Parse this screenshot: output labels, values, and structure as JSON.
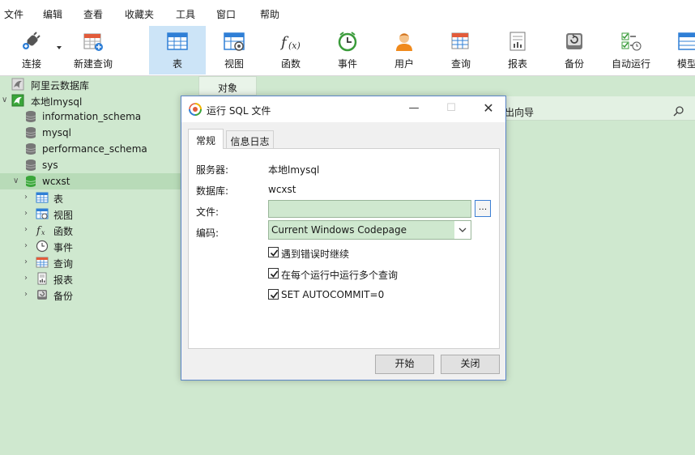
{
  "menu": [
    "文件",
    "编辑",
    "查看",
    "收藏夹",
    "工具",
    "窗口",
    "帮助"
  ],
  "toolbar": {
    "connect": "连接",
    "new_query": "新建查询",
    "table": "表",
    "view": "视图",
    "function": "函数",
    "event": "事件",
    "user": "用户",
    "query": "查询",
    "report": "报表",
    "backup": "备份",
    "automation": "自动运行",
    "model": "模型"
  },
  "sidebar": {
    "connections": [
      {
        "label": "阿里云数据库",
        "icon": "dolphin-icon"
      },
      {
        "label": "本地lmysql",
        "icon": "dolphin-icon"
      }
    ],
    "databases": [
      "information_schema",
      "mysql",
      "performance_schema",
      "sys",
      "wcxst"
    ],
    "children": [
      {
        "label": "表",
        "icon": "table-icon"
      },
      {
        "label": "视图",
        "icon": "view-icon"
      },
      {
        "label": "函数",
        "icon": "function-icon"
      },
      {
        "label": "事件",
        "icon": "clock-icon"
      },
      {
        "label": "查询",
        "icon": "query-icon"
      },
      {
        "label": "报表",
        "icon": "report-icon"
      },
      {
        "label": "备份",
        "icon": "backup-icon"
      }
    ]
  },
  "main": {
    "tab_object": "对象",
    "guide_text": "出向导"
  },
  "dialog": {
    "title": "运行 SQL 文件",
    "tabs": [
      "常规",
      "信息日志"
    ],
    "server_label": "服务器:",
    "server_value": "本地lmysql",
    "database_label": "数据库:",
    "database_value": "wcxst",
    "file_label": "文件:",
    "file_value": "",
    "browse_label": "...",
    "encoding_label": "编码:",
    "encoding_value": "Current Windows Codepage",
    "options": [
      {
        "label": "遇到错误时继续",
        "checked": true
      },
      {
        "label": "在每个运行中运行多个查询",
        "checked": true
      },
      {
        "label": "SET AUTOCOMMIT=0",
        "checked": true
      }
    ],
    "start_button": "开始",
    "close_button": "关闭"
  },
  "colors": {
    "panel_green": "#cfe8cf",
    "selected_green": "#b8dbb8",
    "active_tool": "#cce4f7",
    "dialog_border": "#5b86c7"
  }
}
